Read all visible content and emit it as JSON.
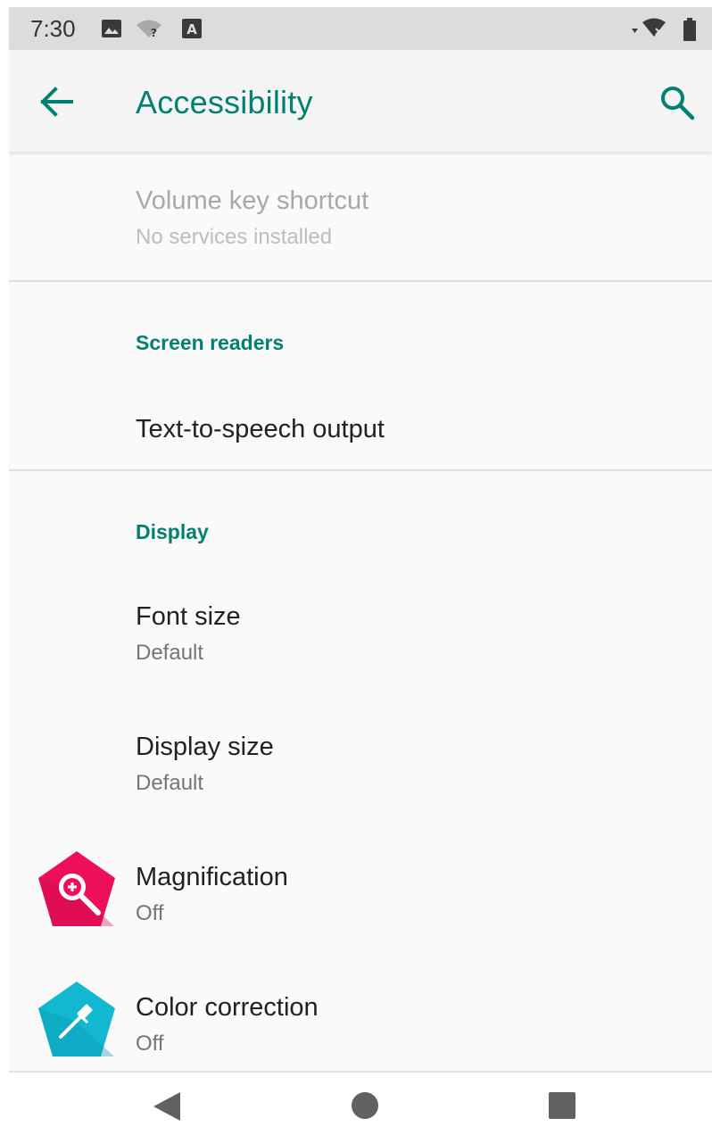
{
  "status_bar": {
    "time": "7:30",
    "icons": [
      "image-icon",
      "wifi-question-icon",
      "text-a-icon",
      "signal-x-icon",
      "battery-icon"
    ]
  },
  "app_bar": {
    "title": "Accessibility",
    "back_icon": "arrow-back-icon",
    "search_icon": "search-icon",
    "accent_color": "#00806f"
  },
  "list": {
    "volume_shortcut": {
      "title": "Volume key shortcut",
      "summary": "No services installed",
      "enabled": false
    },
    "screen_readers": {
      "category": "Screen readers",
      "tts": {
        "title": "Text-to-speech output"
      }
    },
    "display": {
      "category": "Display",
      "font_size": {
        "title": "Font size",
        "summary": "Default"
      },
      "display_size": {
        "title": "Display size",
        "summary": "Default"
      },
      "magnification": {
        "title": "Magnification",
        "summary": "Off",
        "icon": "magnification-icon",
        "icon_color": "#ee0f5c"
      },
      "color_correction": {
        "title": "Color correction",
        "summary": "Off",
        "icon": "color-correction-icon",
        "icon_color": "#12b8d2"
      }
    }
  },
  "nav_bar": {
    "icons": [
      "nav-back-icon",
      "nav-home-icon",
      "nav-recents-icon"
    ]
  }
}
